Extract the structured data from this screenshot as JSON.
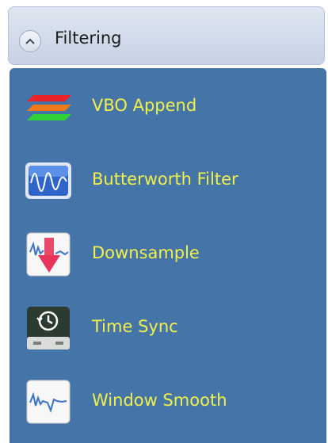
{
  "group": {
    "title": "Filtering",
    "expanded": true
  },
  "colors": {
    "panel_background": "#4574a9",
    "item_label": "#f1f14a",
    "header_background": "#c6d2e5"
  },
  "items": [
    {
      "label": "VBO Append",
      "icon": "stacked-layers-icon"
    },
    {
      "label": "Butterworth Filter",
      "icon": "waveform-filter-icon"
    },
    {
      "label": "Downsample",
      "icon": "downsample-arrow-icon"
    },
    {
      "label": "Time Sync",
      "icon": "clock-history-icon"
    },
    {
      "label": "Window Smooth",
      "icon": "smooth-waveform-icon"
    }
  ]
}
